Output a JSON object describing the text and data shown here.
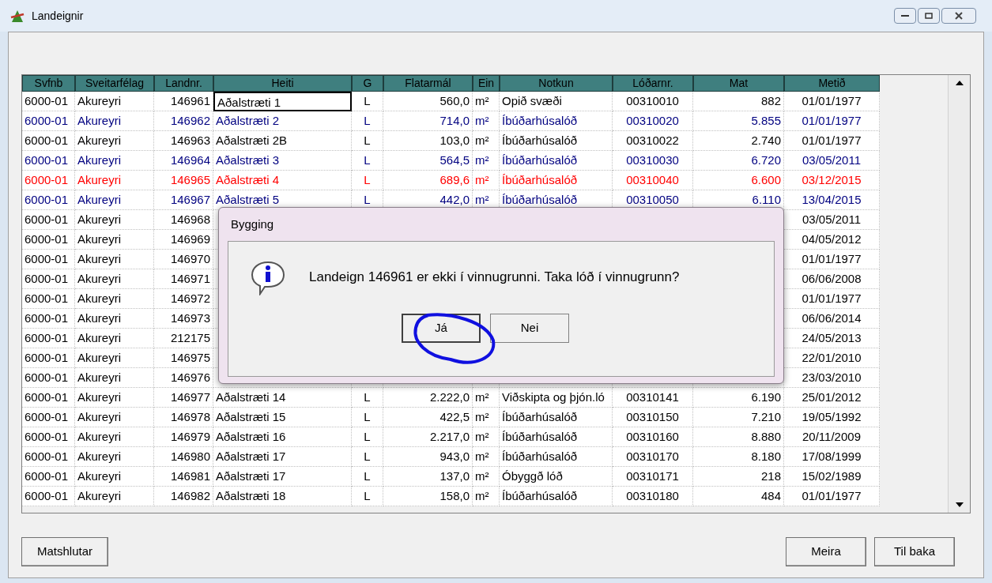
{
  "window": {
    "title": "Landeignir"
  },
  "table": {
    "columns": [
      "Svfnb",
      "Sveitarfélag",
      "Landnr.",
      "Heiti",
      "G",
      "Flatarmál",
      "Ein",
      "Notkun",
      "Lóðarnr.",
      "Mat",
      "Metið"
    ],
    "rows": [
      {
        "color": "#000000",
        "selected": true,
        "cells": [
          "6000-01",
          "Akureyri",
          "146961",
          "Aðalstræti 1",
          "L",
          "560,0",
          "m²",
          "Opið svæði",
          "00310010",
          "882",
          "01/01/1977"
        ]
      },
      {
        "color": "#000080",
        "selected": false,
        "cells": [
          "6000-01",
          "Akureyri",
          "146962",
          "Aðalstræti 2",
          "L",
          "714,0",
          "m²",
          "Íbúðarhúsalóð",
          "00310020",
          "5.855",
          "01/01/1977"
        ]
      },
      {
        "color": "#000000",
        "selected": false,
        "cells": [
          "6000-01",
          "Akureyri",
          "146963",
          "Aðalstræti 2B",
          "L",
          "103,0",
          "m²",
          "Íbúðarhúsalóð",
          "00310022",
          "2.740",
          "01/01/1977"
        ]
      },
      {
        "color": "#000080",
        "selected": false,
        "cells": [
          "6000-01",
          "Akureyri",
          "146964",
          "Aðalstræti 3",
          "L",
          "564,5",
          "m²",
          "Íbúðarhúsalóð",
          "00310030",
          "6.720",
          "03/05/2011"
        ]
      },
      {
        "color": "#ff0000",
        "selected": false,
        "cells": [
          "6000-01",
          "Akureyri",
          "146965",
          "Aðalstræti 4",
          "L",
          "689,6",
          "m²",
          "Íbúðarhúsalóð",
          "00310040",
          "6.600",
          "03/12/2015"
        ]
      },
      {
        "color": "#000080",
        "selected": false,
        "cells": [
          "6000-01",
          "Akureyri",
          "146967",
          "Aðalstræti 5",
          "L",
          "442,0",
          "m²",
          "Íbúðarhúsalóð",
          "00310050",
          "6.110",
          "13/04/2015"
        ]
      },
      {
        "color": "#000000",
        "selected": false,
        "cells": [
          "6000-01",
          "Akureyri",
          "146968",
          null,
          null,
          null,
          null,
          null,
          null,
          null,
          "03/05/2011"
        ]
      },
      {
        "color": "#000000",
        "selected": false,
        "cells": [
          "6000-01",
          "Akureyri",
          "146969",
          null,
          null,
          null,
          null,
          null,
          null,
          null,
          "04/05/2012"
        ]
      },
      {
        "color": "#000000",
        "selected": false,
        "cells": [
          "6000-01",
          "Akureyri",
          "146970",
          null,
          null,
          null,
          null,
          null,
          null,
          null,
          "01/01/1977"
        ]
      },
      {
        "color": "#000000",
        "selected": false,
        "cells": [
          "6000-01",
          "Akureyri",
          "146971",
          null,
          null,
          null,
          null,
          null,
          null,
          null,
          "06/06/2008"
        ]
      },
      {
        "color": "#000000",
        "selected": false,
        "cells": [
          "6000-01",
          "Akureyri",
          "146972",
          null,
          null,
          null,
          null,
          null,
          null,
          null,
          "01/01/1977"
        ]
      },
      {
        "color": "#000000",
        "selected": false,
        "cells": [
          "6000-01",
          "Akureyri",
          "146973",
          null,
          null,
          null,
          null,
          null,
          null,
          null,
          "06/06/2014"
        ]
      },
      {
        "color": "#000000",
        "selected": false,
        "cells": [
          "6000-01",
          "Akureyri",
          "212175",
          null,
          null,
          null,
          null,
          null,
          null,
          null,
          "24/05/2013"
        ]
      },
      {
        "color": "#000000",
        "selected": false,
        "cells": [
          "6000-01",
          "Akureyri",
          "146975",
          null,
          null,
          null,
          null,
          null,
          null,
          null,
          "22/01/2010"
        ]
      },
      {
        "color": "#000000",
        "selected": false,
        "cells": [
          "6000-01",
          "Akureyri",
          "146976",
          null,
          null,
          null,
          null,
          null,
          null,
          null,
          "23/03/2010"
        ]
      },
      {
        "color": "#000000",
        "selected": false,
        "cells": [
          "6000-01",
          "Akureyri",
          "146977",
          "Aðalstræti 14",
          "L",
          "2.222,0",
          "m²",
          "Viðskipta og þjón.ló",
          "00310141",
          "6.190",
          "25/01/2012"
        ]
      },
      {
        "color": "#000000",
        "selected": false,
        "cells": [
          "6000-01",
          "Akureyri",
          "146978",
          "Aðalstræti 15",
          "L",
          "422,5",
          "m²",
          "Íbúðarhúsalóð",
          "00310150",
          "7.210",
          "19/05/1992"
        ]
      },
      {
        "color": "#000000",
        "selected": false,
        "cells": [
          "6000-01",
          "Akureyri",
          "146979",
          "Aðalstræti 16",
          "L",
          "2.217,0",
          "m²",
          "Íbúðarhúsalóð",
          "00310160",
          "8.880",
          "20/11/2009"
        ]
      },
      {
        "color": "#000000",
        "selected": false,
        "cells": [
          "6000-01",
          "Akureyri",
          "146980",
          "Aðalstræti 17",
          "L",
          "943,0",
          "m²",
          "Íbúðarhúsalóð",
          "00310170",
          "8.180",
          "17/08/1999"
        ]
      },
      {
        "color": "#000000",
        "selected": false,
        "cells": [
          "6000-01",
          "Akureyri",
          "146981",
          "Aðalstræti 17",
          "L",
          "137,0",
          "m²",
          "Óbyggð lóð",
          "00310171",
          "218",
          "15/02/1989"
        ]
      },
      {
        "color": "#000000",
        "selected": false,
        "cells": [
          "6000-01",
          "Akureyri",
          "146982",
          "Aðalstræti 18",
          "L",
          "158,0",
          "m²",
          "Íbúðarhúsalóð",
          "00310180",
          "484",
          "01/01/1977"
        ]
      }
    ]
  },
  "buttons_left": [
    "Matshlutar"
  ],
  "buttons_right": [
    "Meira",
    "Til baka"
  ],
  "dialog": {
    "title": "Bygging",
    "message": "Landeign 146961 er ekki í vinnugrunni. Taka lóð í vinnugrunn?",
    "buttons": [
      {
        "label": "Já",
        "selected": true
      },
      {
        "label": "Nei",
        "selected": false
      }
    ]
  }
}
